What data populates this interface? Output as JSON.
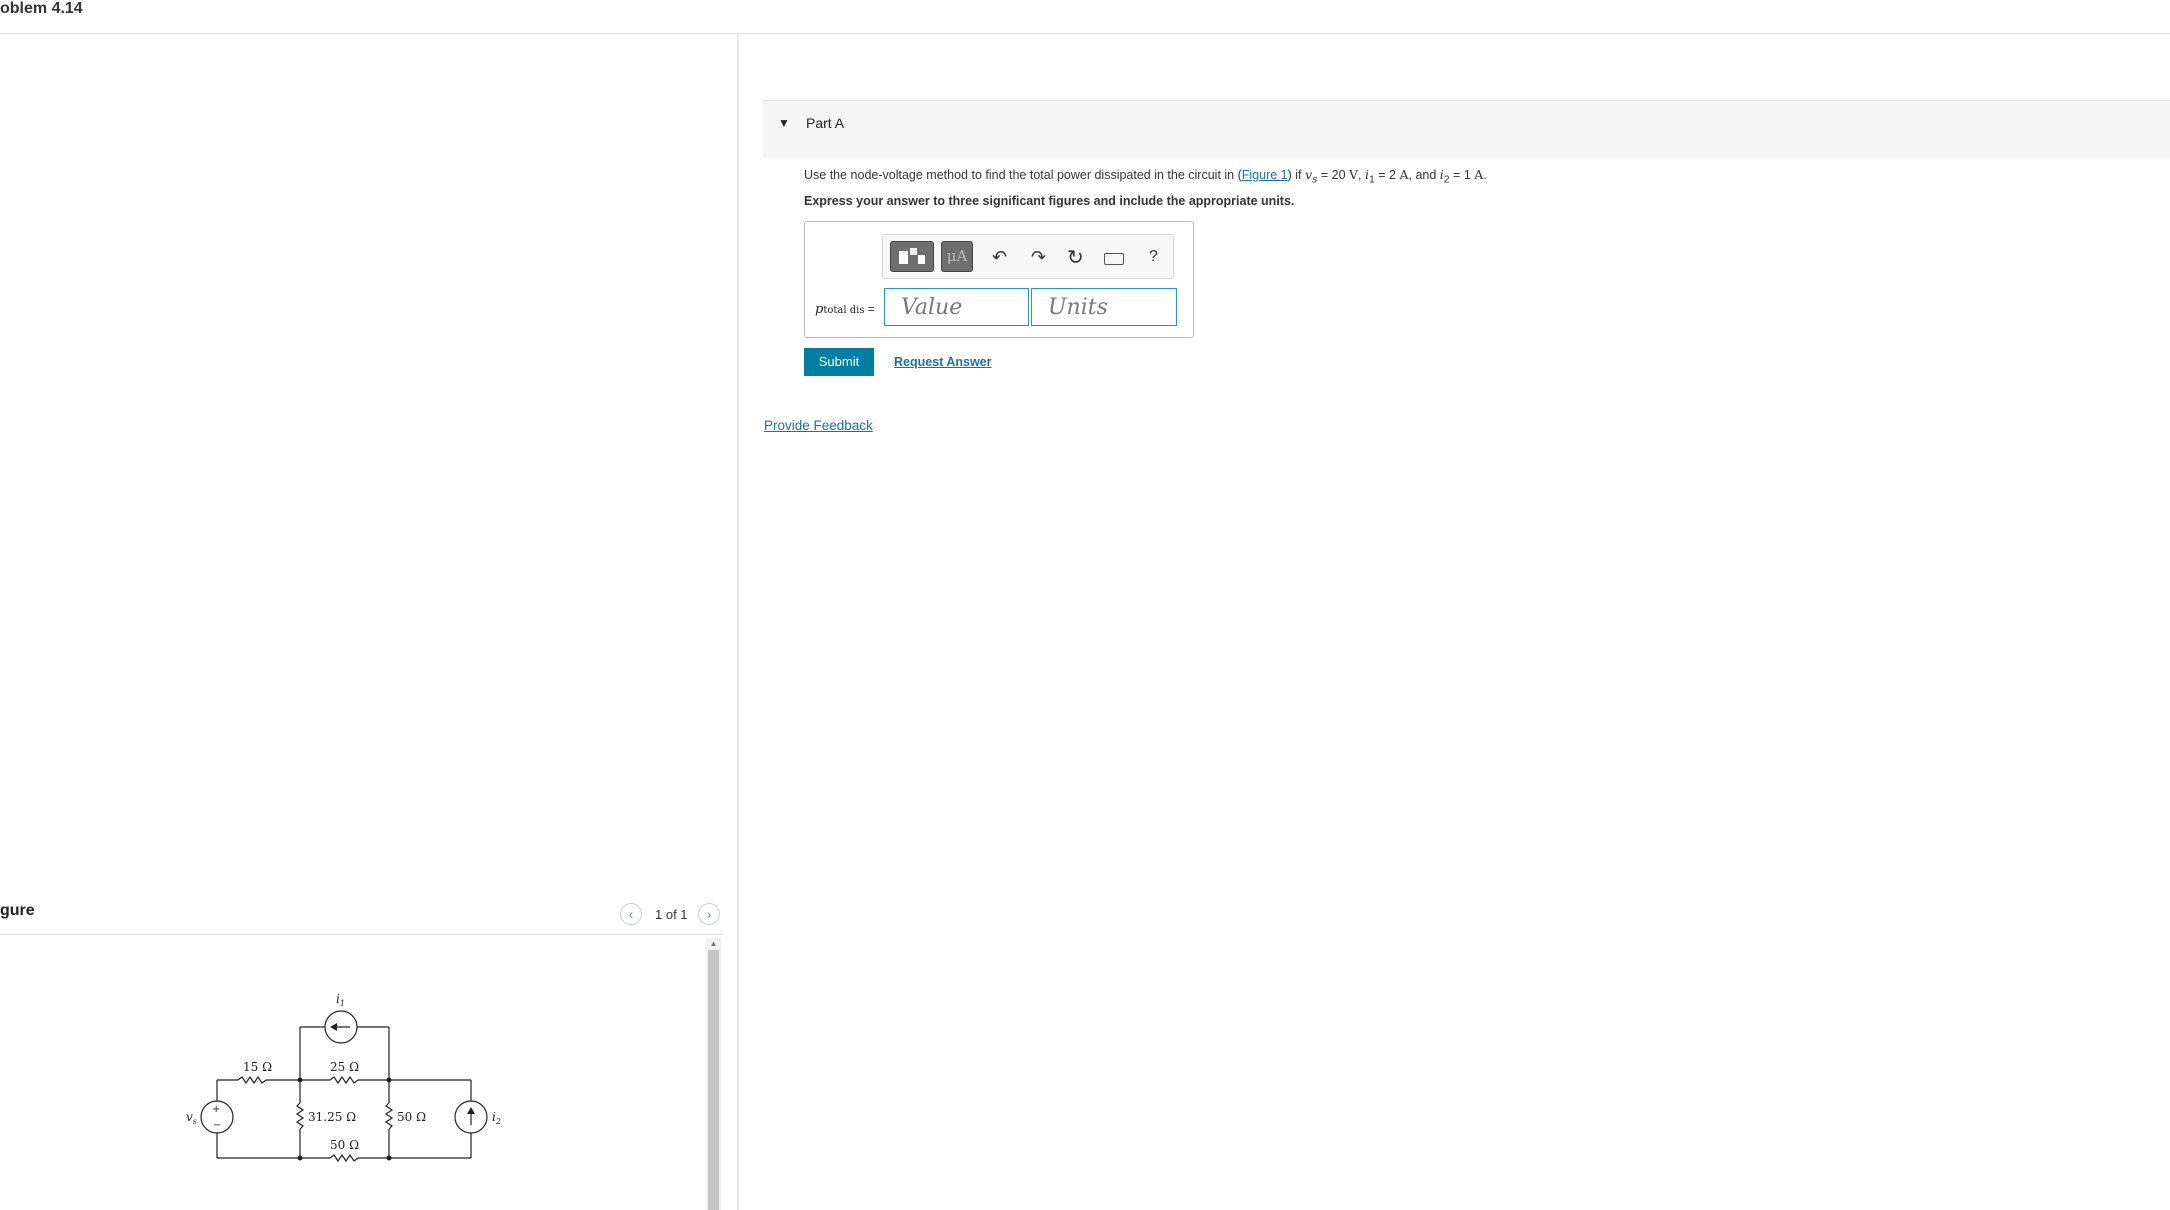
{
  "problem_title": "oblem 4.14",
  "figure_panel": {
    "label": "gure",
    "pager": {
      "text": "1 of 1",
      "prev_icon": "chevron-left-icon",
      "next_icon": "chevron-right-icon"
    },
    "circuit": {
      "labels": {
        "vs": "v",
        "vs_sub": "s",
        "i1": "i",
        "i1_sub": "1",
        "i2": "i",
        "i2_sub": "2",
        "r15": "15 Ω",
        "r25": "25 Ω",
        "r3125": "31.25 Ω",
        "r50_right": "50 Ω",
        "r50_bottom": "50 Ω",
        "plus": "+",
        "minus": "−"
      }
    }
  },
  "part_a": {
    "title": "Part A",
    "question": {
      "before": "Use the node-voltage method to find the total power dissipated in the circuit in (",
      "figure_link": "Figure 1",
      "after_link": ") if ",
      "vs": "v",
      "vs_sub": "s",
      "vs_eq": " = 20 ",
      "vs_unit": "V",
      "sep1": ", ",
      "i1": "i",
      "i1_sub": "1",
      "i1_eq": " = 2 ",
      "i1_unit": "A",
      "sep2": ", and ",
      "i2": "i",
      "i2_sub": "2",
      "i2_eq": " = 1 ",
      "i2_unit": "A",
      "end": "."
    },
    "instruction": "Express your answer to three significant figures and include the appropriate units.",
    "toolbar": {
      "units_button": "μA",
      "help": "?",
      "icons": [
        "templates-icon",
        "units-icon",
        "undo-icon",
        "redo-icon",
        "reset-icon",
        "keyboard-icon",
        "help-icon"
      ]
    },
    "answer": {
      "label_p": "p",
      "label_sub": "total dis",
      "label_eq": " =",
      "value_placeholder": "Value",
      "units_placeholder": "Units"
    },
    "submit": "Submit",
    "request_answer": "Request Answer"
  },
  "provide_feedback": "Provide Feedback",
  "colors": {
    "accent": "#007fa3",
    "link": "#1a6fa8",
    "input_border": "#2a94c6"
  }
}
